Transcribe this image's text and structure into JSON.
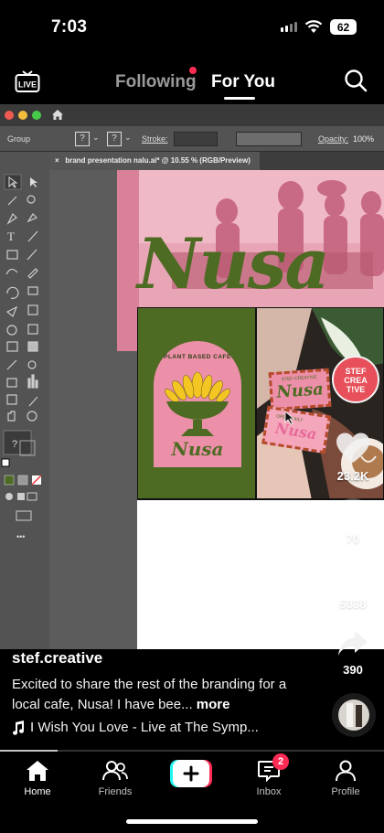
{
  "status_bar": {
    "time": "7:03",
    "battery": "62"
  },
  "top_nav": {
    "live_label": "LIVE",
    "tabs": [
      {
        "label": "Following"
      },
      {
        "label": "For You"
      }
    ]
  },
  "illustrator": {
    "workspace_label": "Group",
    "stroke_label": "Stroke:",
    "opacity_label": "Opacity:",
    "opacity_value": "100%",
    "doc_tab_close": "×",
    "doc_tab_title": "brand presentation nalu.ai* @ 10.55 % (RGB/Preview)",
    "tool_question": "?",
    "tools_more": "•••"
  },
  "artwork": {
    "brand_name": "Nusa",
    "badge_tagline": "PLANT BASED CAFE",
    "logo_text": "Nusa",
    "sticker_top_small": "STEF·CREATIVE",
    "sticker_top_big": "Nusa",
    "sticker_bottom_small": "OPEN DAILY",
    "sticker_bottom_big": "Nusa",
    "stef_badge_lines": [
      "STEF",
      "CREA",
      "T!VE"
    ],
    "brand_color_green": "#4e6b24",
    "brand_color_pink": "#ec8fa8"
  },
  "actions": {
    "likes": "23.2K",
    "comments": "70",
    "saves": "5338",
    "shares": "390"
  },
  "post": {
    "username": "stef.creative",
    "caption": "Excited to share the rest of the branding for a local cafe, Nusa! I have bee...",
    "more_label": "more",
    "music": "I Wish You Love - Live at The Symp...",
    "progress": 0.15
  },
  "tab_bar": {
    "home": "Home",
    "friends": "Friends",
    "inbox": "Inbox",
    "inbox_badge": "2",
    "profile": "Profile",
    "accent": "#fe2c55"
  }
}
